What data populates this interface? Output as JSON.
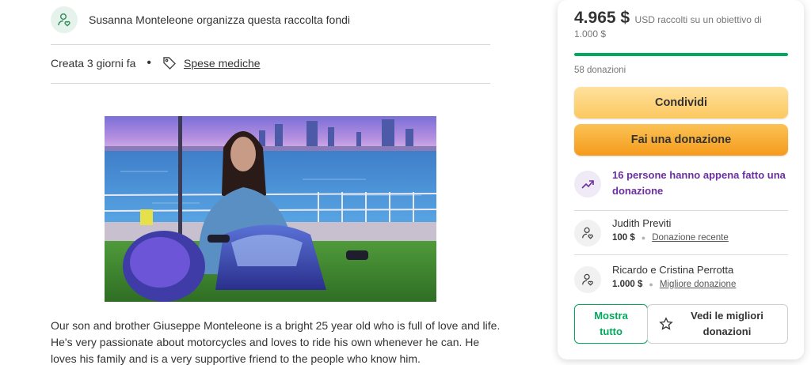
{
  "organizer": {
    "icon": "user-heart-icon",
    "text": "Susanna Monteleone organizza questa raccolta fondi"
  },
  "meta": {
    "created": "Creata 3 giorni fa",
    "separator": "•",
    "category_icon": "tag-icon",
    "category": "Spese mediche"
  },
  "hero": {
    "alt": "Young man with long hair sitting on a blue motorcycle by the waterfront at dusk"
  },
  "story": {
    "lines": [
      "Our son and brother Giuseppe Monteleone is a bright 25 year old who is full of love and life.",
      "He's very passionate about motorcycles and loves to ride his own whenever he can. He",
      "loves his family and is a very supportive friend to the people who know him."
    ]
  },
  "donation_card": {
    "raised_amount": "4.965 $",
    "raised_suffix": "USD raccolti su un obiettivo di",
    "goal": "1.000 $",
    "progress_fraction": 1.0,
    "donation_count": "58 donazioni",
    "share_label": "Condividi",
    "donate_label": "Fai una donazione",
    "trend_icon": "trending-up-icon",
    "trend_text": "16 persone hanno appena fatto una donazione",
    "donors": [
      {
        "name": "Judith Previti",
        "amount": "100 $",
        "tag": "Donazione recente"
      },
      {
        "name": "Ricardo e Cristina Perrotta",
        "amount": "1.000 $",
        "tag": "Migliore donazione"
      }
    ],
    "show_all_label": "Mostra tutto",
    "top_donations_label": "Vedi le migliori donazioni",
    "colors": {
      "accent_green": "#02a95c",
      "share_yellow": "#fcc85f",
      "donate_orange": "#f59b1c",
      "trend_purple": "#6b2fa0"
    }
  }
}
